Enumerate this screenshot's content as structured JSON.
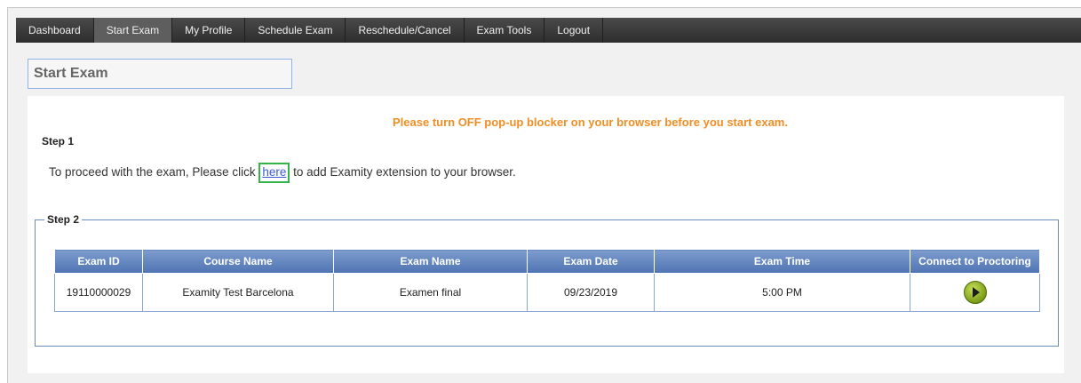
{
  "nav": {
    "items": [
      {
        "label": "Dashboard",
        "active": false
      },
      {
        "label": "Start Exam",
        "active": true
      },
      {
        "label": "My Profile",
        "active": false
      },
      {
        "label": "Schedule Exam",
        "active": false
      },
      {
        "label": "Reschedule/Cancel",
        "active": false
      },
      {
        "label": "Exam Tools",
        "active": false
      },
      {
        "label": "Logout",
        "active": false
      }
    ]
  },
  "page": {
    "title": "Start Exam",
    "notice": "Please turn OFF pop-up blocker on your browser before you start exam.",
    "step1": {
      "label": "Step 1",
      "text_before": "To proceed with the exam, Please click ",
      "link": "here",
      "text_after": " to add Examity extension to your browser."
    },
    "step2": {
      "label": "Step 2",
      "table": {
        "headers": [
          "Exam ID",
          "Course Name",
          "Exam Name",
          "Exam Date",
          "Exam Time",
          "Connect to Proctoring"
        ],
        "rows": [
          {
            "exam_id": "19110000029",
            "course_name": "Examity Test Barcelona",
            "exam_name": "Examen final",
            "exam_date": "09/23/2019",
            "exam_time": "5:00 PM",
            "action_icon": "play-icon"
          }
        ]
      }
    }
  },
  "colors": {
    "notice": "#ef8e25",
    "nav_bg": "#3a3a3a",
    "table_header": "#5b7fbc",
    "highlight_box": "#34b34a",
    "link": "#3b5bd6"
  }
}
